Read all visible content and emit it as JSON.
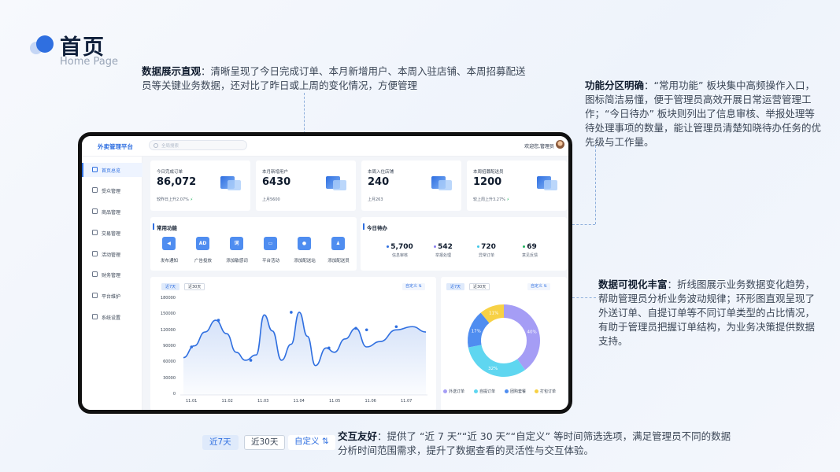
{
  "header": {
    "title": "首页",
    "subtitle": "Home Page"
  },
  "callouts": {
    "data_display": {
      "title": "数据展示直观",
      "text": "：清晰呈现了今日完成订单、本月新增用户、本周入驻店铺、本周招募配送员等关键业务数据，还对比了昨日或上周的变化情况，方便管理"
    },
    "function_zone": {
      "title": "功能分区明确",
      "text": "：“常用功能” 板块集中高频操作入口，图标简洁易懂，便于管理员高效开展日常运营管理工作；“今日待办” 板块则列出了信息审核、举报处理等待处理事项的数量，能让管理员清楚知晓待办任务的优先级与工作量。"
    },
    "visualization": {
      "title": "数据可视化丰富",
      "text": "：折线图展示业务数据变化趋势，帮助管理员分析业务波动规律；环形图直观呈现了外送订单、自提订单等不同订单类型的占比情况，有助于管理员把握订单结构，为业务决策提供数据支持。"
    },
    "interaction": {
      "title": "交互友好",
      "text": "：提供了 “近 7 天”“近 30 天”“自定义” 等时间筛选选项，满足管理员不同的数据分析时间范围需求，提升了数据查看的灵活性与交互体验。"
    }
  },
  "filter_demo": {
    "last7": "近7天",
    "last30": "近30天",
    "custom": "自定义 ⇅"
  },
  "app": {
    "name": "外卖管理平台",
    "search_placeholder": "全局搜索",
    "welcome": "欢迎您,管理员",
    "menu": [
      {
        "label": "首页总览",
        "icon": "home-icon",
        "active": true
      },
      {
        "label": "受众管理",
        "icon": "audience-icon"
      },
      {
        "label": "商品管理",
        "icon": "goods-icon"
      },
      {
        "label": "交易管理",
        "icon": "trade-icon"
      },
      {
        "label": "活动管理",
        "icon": "activity-icon"
      },
      {
        "label": "财务管理",
        "icon": "finance-icon"
      },
      {
        "label": "平台维护",
        "icon": "maintain-icon"
      },
      {
        "label": "系统设置",
        "icon": "settings-icon"
      }
    ],
    "stats": [
      {
        "label": "今日完成订单",
        "value": "86,072",
        "sub": "较昨日上升2.07%",
        "trend": "up"
      },
      {
        "label": "本月新增用户",
        "value": "6430",
        "sub": "上月5600"
      },
      {
        "label": "本周入住店铺",
        "value": "240",
        "sub": "上月263"
      },
      {
        "label": "本周招募配送员",
        "value": "1200",
        "sub": "较上周上升3.27%",
        "trend": "up"
      }
    ],
    "quick_functions": {
      "title": "常用功能",
      "items": [
        {
          "label": "发布通知",
          "icon": "megaphone-icon",
          "glyph": "◀"
        },
        {
          "label": "广告投放",
          "icon": "ad-icon",
          "glyph": "AD"
        },
        {
          "label": "添加敏感词",
          "icon": "word-icon",
          "glyph": "词"
        },
        {
          "label": "平台活动",
          "icon": "ticket-icon",
          "glyph": "▭"
        },
        {
          "label": "添加配送站",
          "icon": "location-icon",
          "glyph": "●"
        },
        {
          "label": "添加配送员",
          "icon": "courier-icon",
          "glyph": "♟"
        }
      ]
    },
    "todo": {
      "title": "今日待办",
      "items": [
        {
          "value": "5,700",
          "label": "信息审核",
          "color": "#2f6fe0"
        },
        {
          "value": "542",
          "label": "举报处理",
          "color": "#8a7ff0"
        },
        {
          "value": "720",
          "label": "异常订单",
          "color": "#3fc7e8"
        },
        {
          "value": "69",
          "label": "意见反馈",
          "color": "#22b35e"
        }
      ]
    },
    "filters": {
      "last7": "近7天",
      "last30": "近30天",
      "custom": "自定义 ⇅"
    }
  },
  "chart_data": [
    {
      "type": "line",
      "x": [
        "11.01",
        "11.02",
        "11.03",
        "11.04",
        "11.05",
        "11.06",
        "11.07"
      ],
      "y_ticks": [
        0,
        30000,
        60000,
        90000,
        120000,
        150000,
        180000
      ],
      "ylim": [
        0,
        180000
      ],
      "smooth_curve": [
        [
          10.8,
          70000
        ],
        [
          11.0,
          92000
        ],
        [
          11.2,
          118000
        ],
        [
          11.4,
          140000
        ],
        [
          11.6,
          115000
        ],
        [
          11.78,
          80000
        ],
        [
          11.95,
          65000
        ],
        [
          12.15,
          75000
        ],
        [
          12.3,
          150000
        ],
        [
          12.45,
          120000
        ],
        [
          12.62,
          65000
        ],
        [
          12.8,
          95000
        ],
        [
          12.95,
          155000
        ],
        [
          13.1,
          110000
        ],
        [
          13.25,
          55000
        ],
        [
          13.45,
          88000
        ],
        [
          13.6,
          80000
        ],
        [
          13.8,
          105000
        ],
        [
          14.0,
          125000
        ],
        [
          14.2,
          90000
        ],
        [
          14.45,
          100000
        ],
        [
          14.75,
          122000
        ],
        [
          15.05,
          128000
        ],
        [
          15.3,
          118000
        ]
      ],
      "marked_points": [
        [
          10.95,
          90000
        ],
        [
          11.45,
          140000
        ],
        [
          12.05,
          65000
        ],
        [
          12.8,
          155000
        ],
        [
          13.5,
          88000
        ],
        [
          14.0,
          125000
        ],
        [
          14.2,
          122000
        ],
        [
          14.75,
          128000
        ]
      ],
      "color": "#2f6fe0"
    },
    {
      "type": "pie",
      "slices": [
        {
          "name": "外送订单",
          "value": 40,
          "color": "#a59df5"
        },
        {
          "name": "自提订单",
          "value": 32,
          "color": "#5fd6f0"
        },
        {
          "name": "团购套餐",
          "value": 17,
          "color": "#4f8df0"
        },
        {
          "name": "打包订单",
          "value": 11,
          "color": "#f7d145"
        }
      ],
      "labels": [
        "40%",
        "32%",
        "17%",
        "11%"
      ]
    }
  ]
}
